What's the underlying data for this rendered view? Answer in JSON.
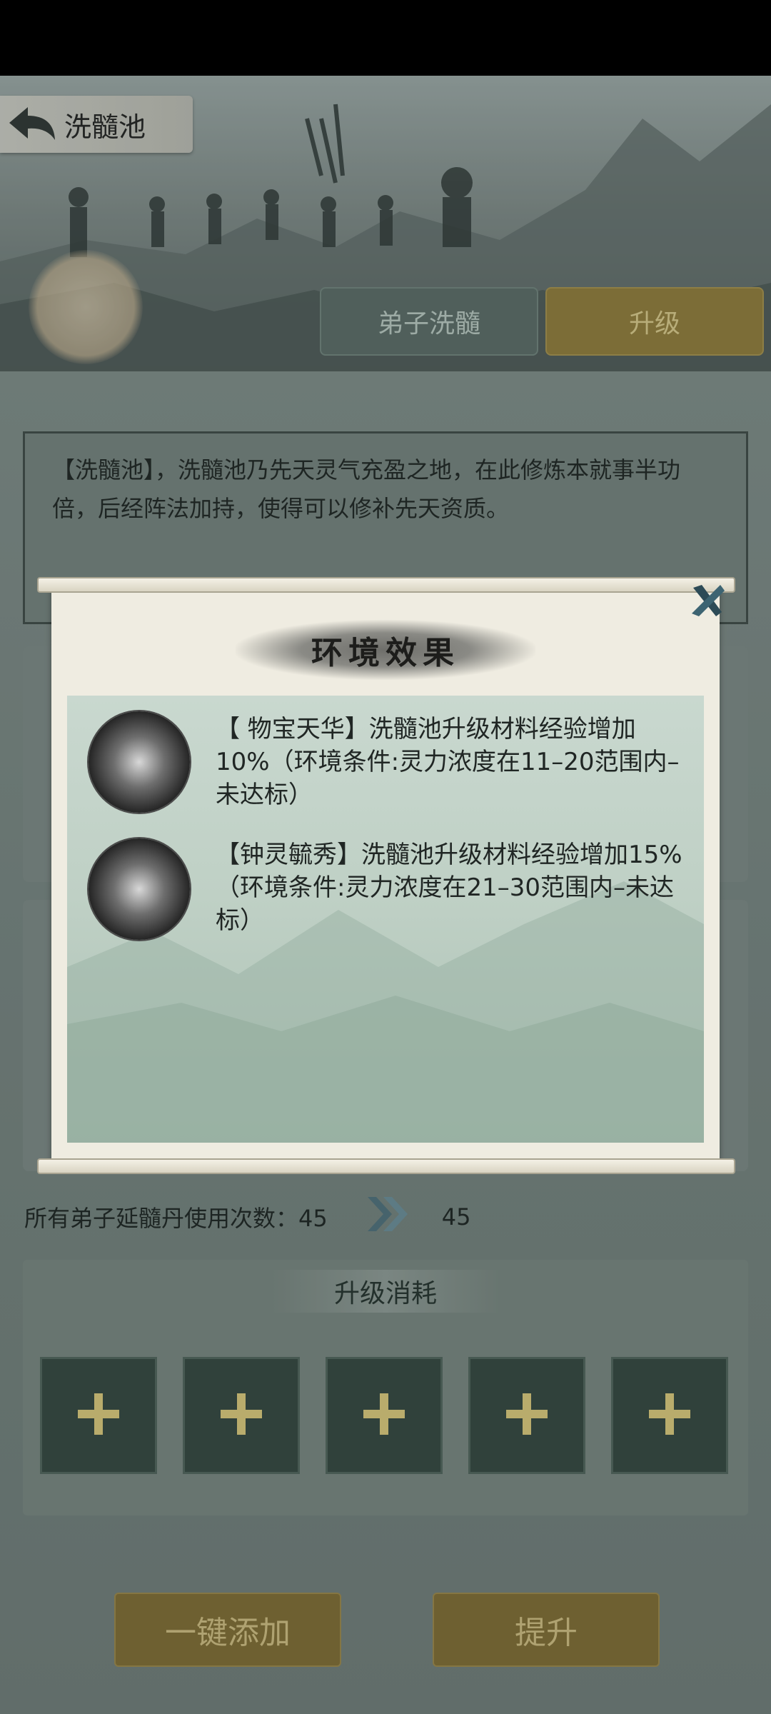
{
  "header": {
    "title": "洗髓池"
  },
  "tabs": [
    {
      "label": "弟子洗髓"
    },
    {
      "label": "升级",
      "active": true
    }
  ],
  "description": "【洗髓池】，洗髓池乃先天灵气充盈之地，在此修炼本就事半功倍，后经阵法加持，使得可以修补先天资质。",
  "uses": {
    "label": "所有弟子延髓丹使用次数：45",
    "current": "45",
    "next": "45"
  },
  "upgrade_cost": {
    "title": "升级消耗",
    "slot_count": 5
  },
  "buttons": {
    "add_all": "一键添加",
    "upgrade": "提升"
  },
  "popup": {
    "title": "环境效果",
    "effects": [
      {
        "text": "【 物宝天华】洗髓池升级材料经验增加10%（环境条件:灵力浓度在11–20范围内–未达标）"
      },
      {
        "text": "【钟灵毓秀】洗髓池升级材料经验增加15%（环境条件:灵力浓度在21–30范围内–未达标）"
      }
    ]
  },
  "colors": {
    "accent_gold": "#8f7a3a",
    "panel": "#74817e",
    "scroll": "#efece1"
  }
}
